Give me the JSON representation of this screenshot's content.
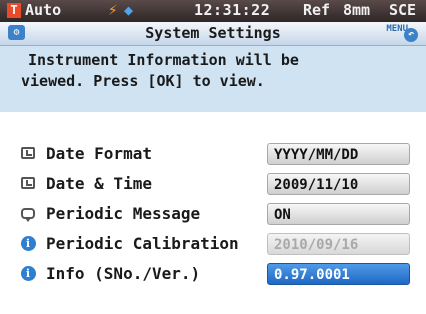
{
  "status_bar": {
    "mode_icon": "T",
    "mode": "Auto",
    "power_icon": "lightning-icon",
    "calibration_icon": "diamond-icon",
    "time": "12:31:22",
    "reference": "Ref",
    "mask": "8mm",
    "specular": "SCE"
  },
  "title_bar": {
    "title": "System Settings",
    "menu_label": "MENU"
  },
  "info_panel": {
    "line1": "Instrument Information will be",
    "line2": "viewed. Press [OK] to view."
  },
  "settings": {
    "rows": [
      {
        "icon": "clock-icon",
        "label": "Date Format",
        "value": "YYYY/MM/DD",
        "state": "normal"
      },
      {
        "icon": "clock-icon",
        "label": "Date & Time",
        "value": "2009/11/10",
        "state": "normal"
      },
      {
        "icon": "message-icon",
        "label": "Periodic Message",
        "value": "ON",
        "state": "normal"
      },
      {
        "icon": "info-icon",
        "label": "Periodic Calibration",
        "value": "2010/09/16",
        "state": "disabled"
      },
      {
        "icon": "info-icon",
        "label": "Info (SNo./Ver.)",
        "value": "0.97.0001",
        "state": "selected"
      }
    ]
  },
  "colors": {
    "status_bg": "#2e2626",
    "title_bg": "#c5d6ea",
    "info_bg": "#cfe3f2",
    "selected_bg": "#1f68c4"
  }
}
